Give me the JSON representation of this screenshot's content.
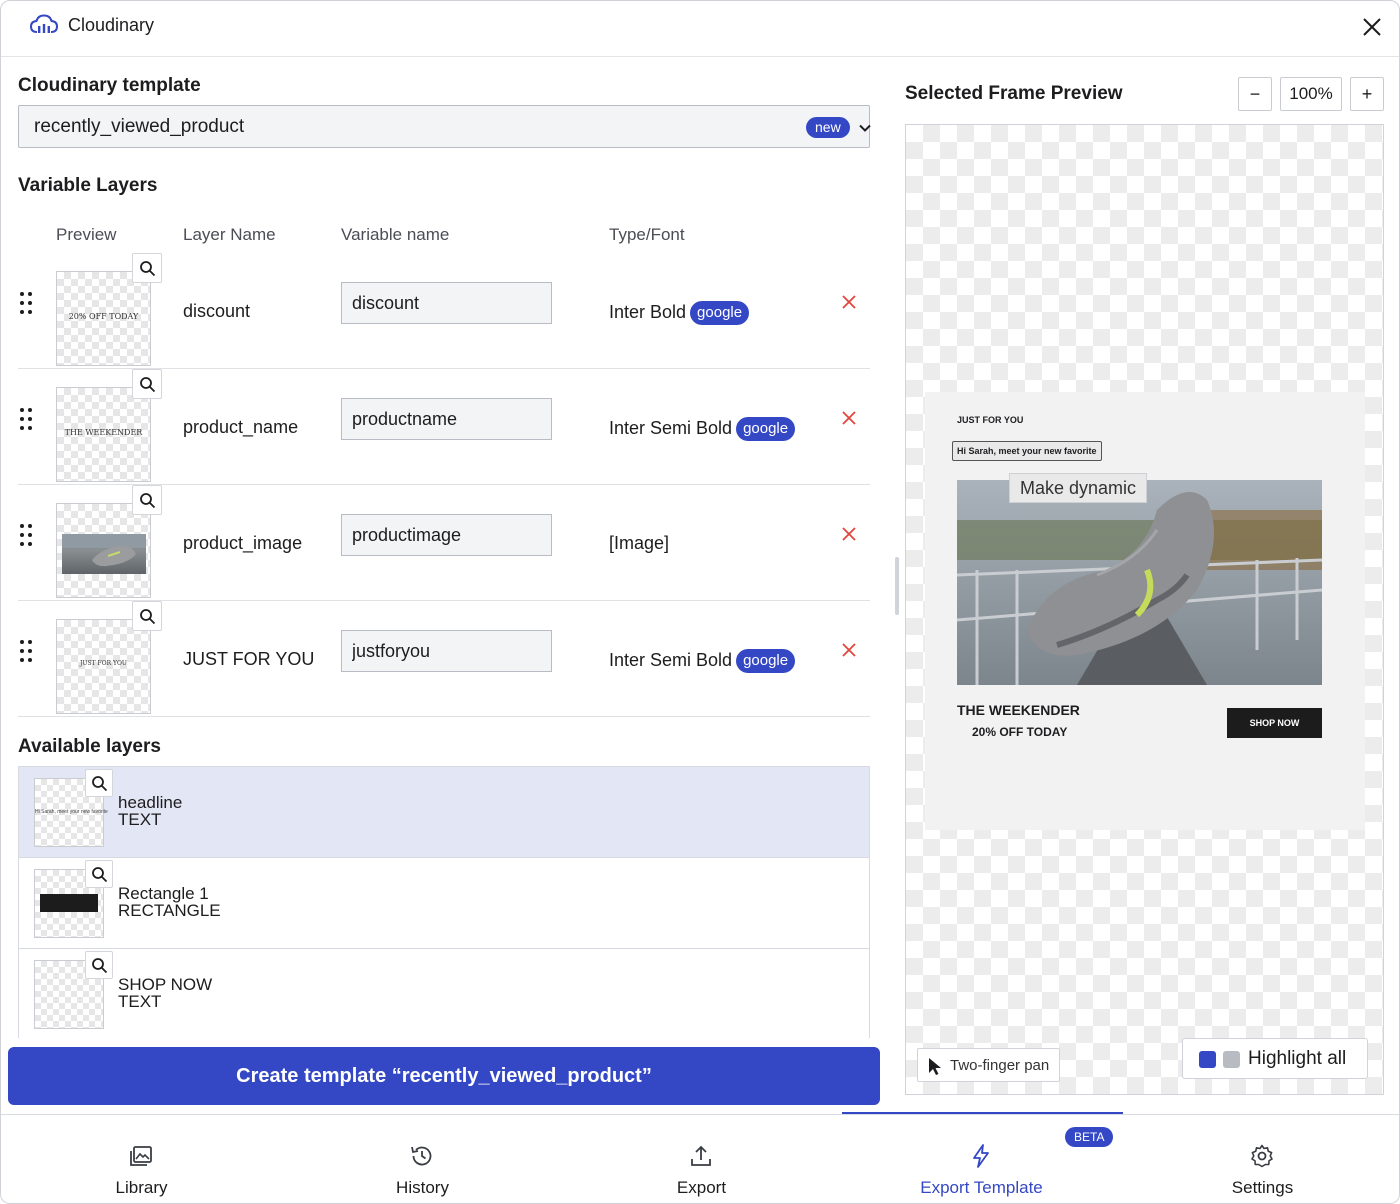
{
  "app": {
    "title": "Cloudinary"
  },
  "left": {
    "template_title": "Cloudinary template",
    "template_value": "recently_viewed_product",
    "template_badge": "new",
    "variable_layers_title": "Variable Layers",
    "columns": {
      "preview": "Preview",
      "layer_name": "Layer Name",
      "variable_name": "Variable name",
      "type_font": "Type/Font"
    },
    "rows": [
      {
        "layer_name": "discount",
        "variable": "discount",
        "type": "Inter Bold",
        "badge": "google",
        "thumb_text": "20% OFF TODAY"
      },
      {
        "layer_name": "product_name",
        "variable": "productname",
        "type": "Inter Semi Bold",
        "badge": "google",
        "thumb_text": "THE WEEKENDER"
      },
      {
        "layer_name": "product_image",
        "variable": "productimage",
        "type": "[Image]",
        "badge": ""
      },
      {
        "layer_name": "JUST FOR YOU",
        "variable": "justforyou",
        "type": "Inter Semi Bold",
        "badge": "google",
        "thumb_text": "JUST FOR YOU"
      }
    ],
    "available_title": "Available layers",
    "available": [
      {
        "name": "headline",
        "type": "TEXT",
        "thumb_text": "Hi Sarah, meet your new favorite"
      },
      {
        "name": "Rectangle 1",
        "type": "RECTANGLE"
      },
      {
        "name": "SHOP NOW",
        "type": "TEXT"
      }
    ],
    "create_button": "Create template “recently_viewed_product”"
  },
  "right": {
    "title": "Selected Frame Preview",
    "zoom": "100%",
    "zoom_out": "−",
    "zoom_in": "+",
    "preview": {
      "just_for_you": "JUST FOR YOU",
      "greeting": "Hi Sarah, meet your new favorite",
      "make_dynamic": "Make dynamic",
      "product_name": "THE WEEKENDER",
      "discount": "20% OFF TODAY",
      "shop_now": "SHOP NOW"
    },
    "pan_hint": "Two-finger pan",
    "highlight_all": "Highlight all",
    "colors": {
      "accent": "#3448c5"
    }
  },
  "nav": {
    "items": [
      {
        "label": "Library",
        "icon": "library-icon"
      },
      {
        "label": "History",
        "icon": "history-icon"
      },
      {
        "label": "Export",
        "icon": "export-icon"
      },
      {
        "label": "Export Template",
        "icon": "lightning-icon"
      },
      {
        "label": "Settings",
        "icon": "gear-icon"
      }
    ],
    "beta_badge": "BETA"
  }
}
